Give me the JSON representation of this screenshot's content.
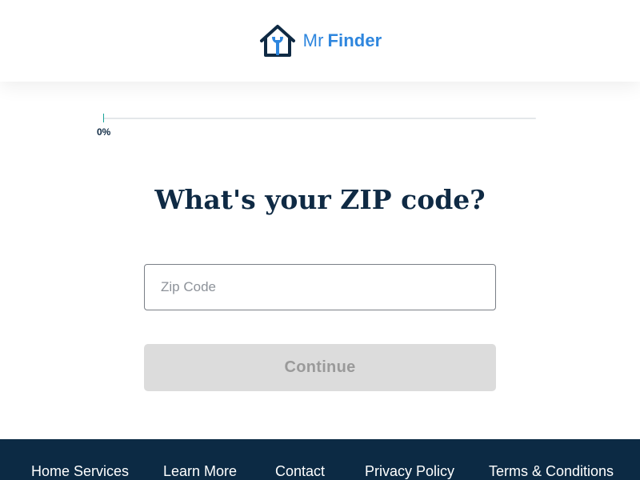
{
  "header": {
    "logo": {
      "prefix": "Mr",
      "name": "Finder",
      "icon": "house-wrench-icon"
    }
  },
  "progress": {
    "percent": 0,
    "label": "0%"
  },
  "question": {
    "title": "What's your ZIP code?"
  },
  "zip": {
    "value": "",
    "placeholder": "Zip Code"
  },
  "actions": {
    "continue_label": "Continue"
  },
  "footer": {
    "links": [
      "Home Services",
      "Learn More",
      "Contact",
      "Privacy Policy",
      "Terms & Conditions"
    ]
  },
  "colors": {
    "navy": "#0f2a44",
    "brand_blue": "#2e86de",
    "progress_accent": "#1aa39a",
    "footer_bg": "#0c2a44",
    "button_disabled": "#dcdcdc"
  }
}
